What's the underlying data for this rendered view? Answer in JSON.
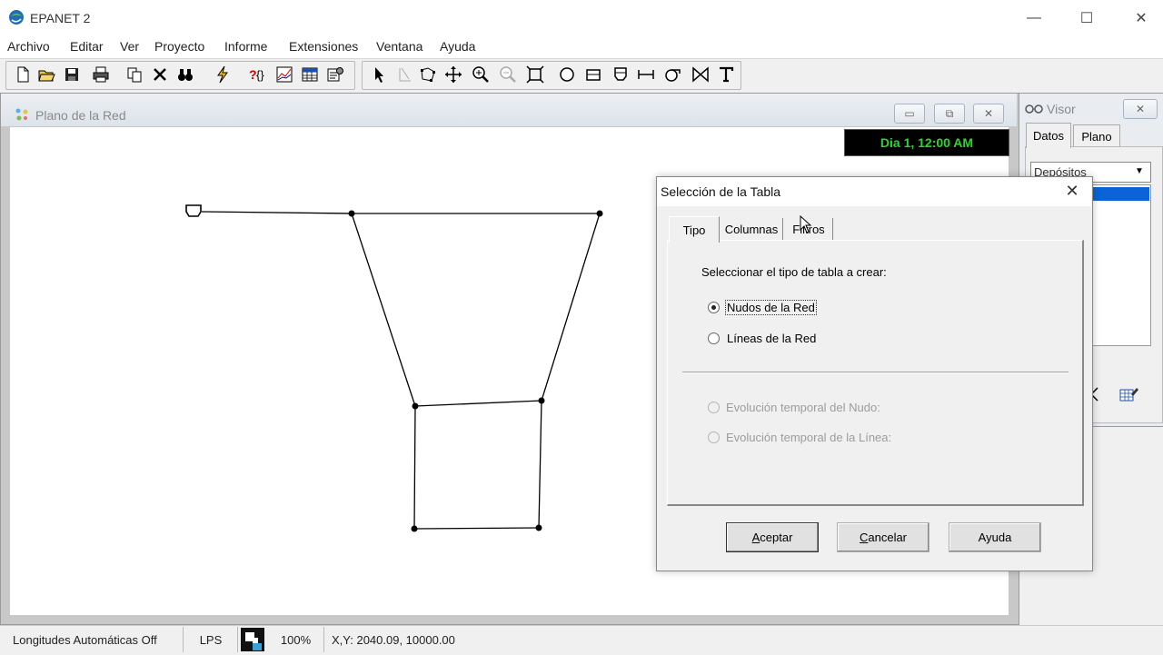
{
  "app": {
    "title": "EPANET 2",
    "controls": {
      "minimize": "—",
      "maximize": "☐",
      "close": "✕"
    }
  },
  "menu": [
    "Archivo",
    "Editar",
    "Ver",
    "Proyecto",
    "Informe",
    "Extensiones",
    "Ventana",
    "Ayuda"
  ],
  "map_window": {
    "title": "Plano de la Red",
    "time_label": "Dia 1, 12:00 AM",
    "controls": {
      "minimize": "▭",
      "restore": "⧉",
      "close": "✕"
    }
  },
  "visor": {
    "title": "Visor",
    "close": "✕",
    "tabs": [
      "Datos",
      "Plano"
    ],
    "selected_category": "Depósitos"
  },
  "dialog": {
    "title": "Selección de la Tabla",
    "close": "✕",
    "tabs": {
      "tipo": "Tipo",
      "columnas": "Columnas",
      "filtros": "Filtros"
    },
    "prompt": "Seleccionar el tipo de tabla a crear:",
    "options": {
      "nodes": "Nudos de la Red",
      "links": "Líneas de la Red",
      "node_series": "Evolución temporal del Nudo:",
      "link_series": "Evolución temporal de la Línea:"
    },
    "buttons": {
      "ok_accel": "A",
      "ok_rest": "ceptar",
      "cancel_accel": "C",
      "cancel_rest": "ancelar",
      "help": "Ayuda"
    }
  },
  "status": {
    "auto_length": "Longitudes Automáticas Off",
    "flow_units": "LPS",
    "zoom": "100%",
    "coords": "X,Y: 2040.09, 10000.00"
  }
}
